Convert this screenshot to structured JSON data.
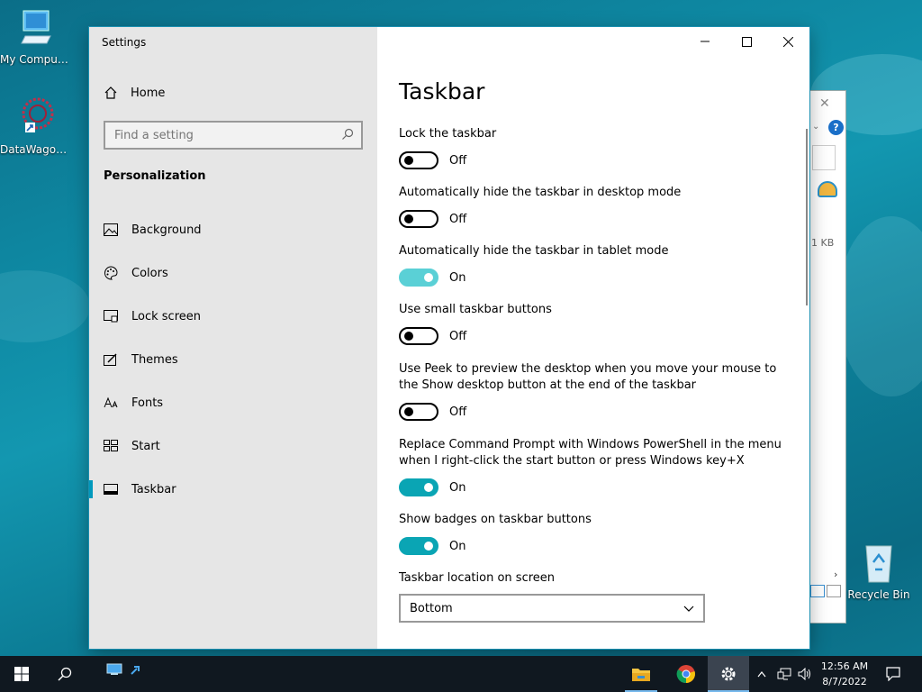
{
  "desktop": {
    "icons": [
      {
        "label": "My Computer"
      },
      {
        "label": "DataWagon..."
      },
      {
        "label": "Recycle Bin"
      }
    ],
    "bg_window": {
      "size_text": "1 KB"
    }
  },
  "window": {
    "title": "Settings",
    "sidebar": {
      "home_label": "Home",
      "search_placeholder": "Find a setting",
      "category": "Personalization",
      "items": [
        {
          "label": "Background",
          "icon": "background-icon"
        },
        {
          "label": "Colors",
          "icon": "palette-icon"
        },
        {
          "label": "Lock screen",
          "icon": "lock-screen-icon"
        },
        {
          "label": "Themes",
          "icon": "themes-icon"
        },
        {
          "label": "Fonts",
          "icon": "fonts-icon"
        },
        {
          "label": "Start",
          "icon": "start-icon"
        },
        {
          "label": "Taskbar",
          "icon": "taskbar-icon",
          "active": true
        }
      ]
    },
    "main": {
      "heading": "Taskbar",
      "settings": [
        {
          "label": "Lock the taskbar",
          "state": "Off"
        },
        {
          "label": "Automatically hide the taskbar in desktop mode",
          "state": "Off"
        },
        {
          "label": "Automatically hide the taskbar in tablet mode",
          "state": "On"
        },
        {
          "label": "Use small taskbar buttons",
          "state": "Off"
        },
        {
          "label": "Use Peek to preview the desktop when you move your mouse to the Show desktop button at the end of the taskbar",
          "state": "Off"
        },
        {
          "label": "Replace Command Prompt with Windows PowerShell in the menu when I right-click the start button or press Windows key+X",
          "state": "On"
        },
        {
          "label": "Show badges on taskbar buttons",
          "state": "On"
        }
      ],
      "location_label": "Taskbar location on screen",
      "location_value": "Bottom"
    }
  },
  "taskbar": {
    "time": "12:56 AM",
    "date": "8/7/2022"
  },
  "colors": {
    "accent": "#0099bc",
    "toggle_on": "#0aa5b4",
    "taskbar_bg": "#101820"
  }
}
